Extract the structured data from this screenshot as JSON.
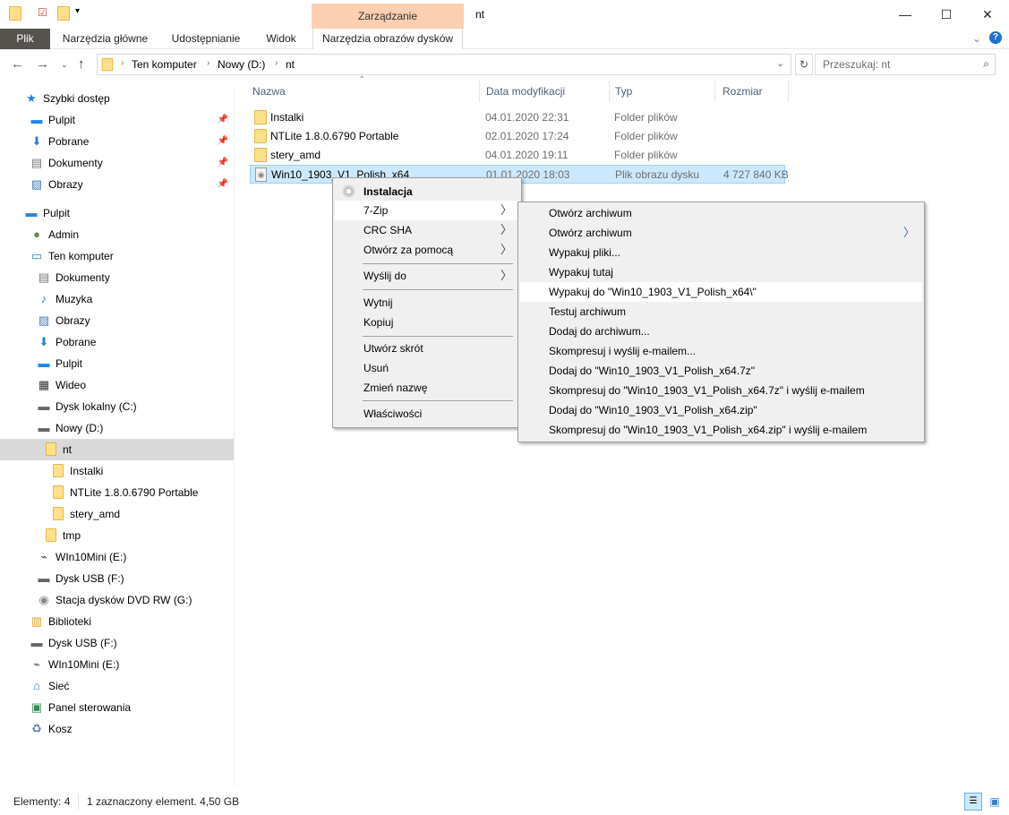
{
  "window": {
    "title": "nt",
    "contextual_group": "Zarządzanie",
    "minimize": "—",
    "maximize": "☐",
    "close": "✕"
  },
  "ribbon": {
    "tabs": [
      "Plik",
      "Narzędzia główne",
      "Udostępnianie",
      "Widok",
      "Narzędzia obrazów dysków"
    ]
  },
  "address": {
    "crumbs": [
      "Ten komputer",
      "Nowy (D:)",
      "nt"
    ],
    "search_placeholder": "Przeszukaj: nt"
  },
  "sidebar": [
    {
      "label": "Szybki dostęp",
      "level": 0,
      "icon": "star-icon",
      "pinned": false
    },
    {
      "label": "Pulpit",
      "level": 1,
      "icon": "desktop-icon",
      "pinned": true
    },
    {
      "label": "Pobrane",
      "level": 1,
      "icon": "download-icon",
      "pinned": true
    },
    {
      "label": "Dokumenty",
      "level": 1,
      "icon": "document-icon",
      "pinned": true
    },
    {
      "label": "Obrazy",
      "level": 1,
      "icon": "pictures-icon",
      "pinned": true
    },
    {
      "label": "Pulpit",
      "level": 0,
      "icon": "desktop-icon",
      "pinned": false,
      "gap": true
    },
    {
      "label": "Admin",
      "level": 1,
      "icon": "user-icon",
      "pinned": false
    },
    {
      "label": "Ten komputer",
      "level": 1,
      "icon": "computer-icon",
      "pinned": false
    },
    {
      "label": "Dokumenty",
      "level": 2,
      "icon": "document-icon",
      "pinned": false
    },
    {
      "label": "Muzyka",
      "level": 2,
      "icon": "music-icon",
      "pinned": false
    },
    {
      "label": "Obrazy",
      "level": 2,
      "icon": "pictures-icon",
      "pinned": false
    },
    {
      "label": "Pobrane",
      "level": 2,
      "icon": "download-icon",
      "pinned": false
    },
    {
      "label": "Pulpit",
      "level": 2,
      "icon": "desktop-icon",
      "pinned": false
    },
    {
      "label": "Wideo",
      "level": 2,
      "icon": "video-icon",
      "pinned": false
    },
    {
      "label": "Dysk lokalny (C:)",
      "level": 2,
      "icon": "drive-icon",
      "pinned": false
    },
    {
      "label": "Nowy (D:)",
      "level": 2,
      "icon": "drive-icon",
      "pinned": false
    },
    {
      "label": "nt",
      "level": 3,
      "icon": "folder-icon",
      "pinned": false,
      "selected": true
    },
    {
      "label": "Instalki",
      "level": 4,
      "icon": "folder-icon",
      "pinned": false
    },
    {
      "label": "NTLite 1.8.0.6790 Portable",
      "level": 4,
      "icon": "folder-icon",
      "pinned": false
    },
    {
      "label": "stery_amd",
      "level": 4,
      "icon": "folder-icon",
      "pinned": false
    },
    {
      "label": "tmp",
      "level": 3,
      "icon": "folder-icon",
      "pinned": false
    },
    {
      "label": "WIn10Mini (E:)",
      "level": 2,
      "icon": "usb-icon",
      "pinned": false
    },
    {
      "label": "Dysk USB (F:)",
      "level": 2,
      "icon": "drive-icon",
      "pinned": false
    },
    {
      "label": "Stacja dysków DVD RW (G:)",
      "level": 2,
      "icon": "dvd-icon",
      "pinned": false
    },
    {
      "label": "Biblioteki",
      "level": 1,
      "icon": "library-icon",
      "pinned": false
    },
    {
      "label": "Dysk USB (F:)",
      "level": 1,
      "icon": "drive-icon",
      "pinned": false
    },
    {
      "label": "WIn10Mini (E:)",
      "level": 1,
      "icon": "usb-icon",
      "pinned": false
    },
    {
      "label": "Sieć",
      "level": 1,
      "icon": "network-icon",
      "pinned": false
    },
    {
      "label": "Panel sterowania",
      "level": 1,
      "icon": "control-panel-icon",
      "pinned": false
    },
    {
      "label": "Kosz",
      "level": 1,
      "icon": "recycle-bin-icon",
      "pinned": false
    }
  ],
  "columns": [
    "Nazwa",
    "Data modyfikacji",
    "Typ",
    "Rozmiar"
  ],
  "files": [
    {
      "name": "Instalki",
      "date": "04.01.2020 22:31",
      "type": "Folder plików",
      "size": ""
    },
    {
      "name": "NTLite 1.8.0.6790 Portable",
      "date": "02.01.2020 17:24",
      "type": "Folder plików",
      "size": ""
    },
    {
      "name": "stery_amd",
      "date": "04.01.2020 19:11",
      "type": "Folder plików",
      "size": ""
    },
    {
      "name": "Win10_1903_V1_Polish_x64",
      "date": "01.01.2020 18:03",
      "type": "Plik obrazu dysku",
      "size": "4 727 840 KB",
      "selected": true
    }
  ],
  "context_menu": {
    "items": [
      "Instalacja",
      "7-Zip",
      "CRC SHA",
      "Otwórz za pomocą",
      "Wyślij do",
      "Wytnij",
      "Kopiuj",
      "Utwórz skrót",
      "Usuń",
      "Zmień nazwę",
      "Właściwości"
    ]
  },
  "submenu_7zip": {
    "items": [
      "Otwórz archiwum",
      "Otwórz archiwum",
      "Wypakuj pliki...",
      "Wypakuj tutaj",
      "Wypakuj do \"Win10_1903_V1_Polish_x64\\\"",
      "Testuj archiwum",
      "Dodaj do archiwum...",
      "Skompresuj i wyślij e-mailem...",
      "Dodaj do \"Win10_1903_V1_Polish_x64.7z\"",
      "Skompresuj do \"Win10_1903_V1_Polish_x64.7z\" i wyślij e-mailem",
      "Dodaj do \"Win10_1903_V1_Polish_x64.zip\"",
      "Skompresuj do \"Win10_1903_V1_Polish_x64.zip\" i wyślij e-mailem"
    ]
  },
  "status": {
    "count": "Elementy: 4",
    "selection": "1 zaznaczony element. 4,50 GB"
  }
}
